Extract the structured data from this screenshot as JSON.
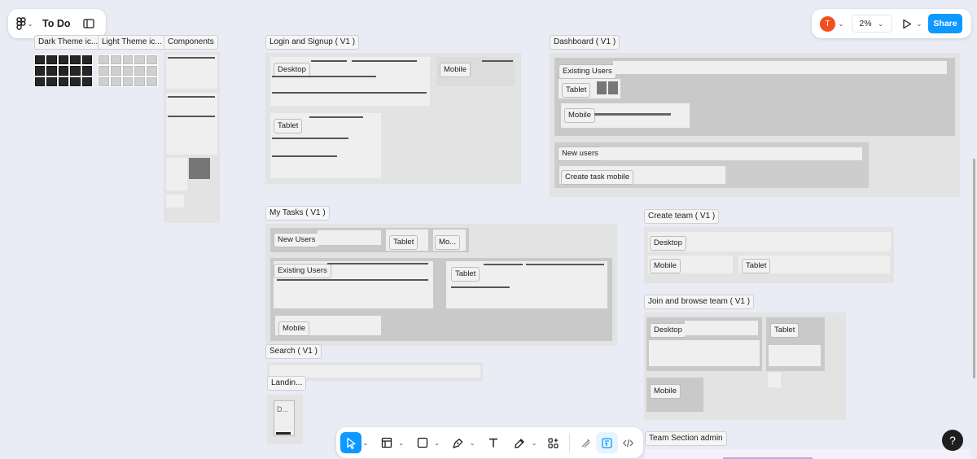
{
  "topbar": {
    "file_name": "To Do",
    "zoom": "2%",
    "avatar_initial": "T",
    "share_label": "Share"
  },
  "frames": {
    "dark_theme": "Dark Theme ic...",
    "light_theme": "Light Theme ic...",
    "components": "Components",
    "login": "Login and Signup ( V1 )",
    "dashboard": "Dashboard ( V1 )",
    "my_tasks": "My Tasks ( V1 )",
    "create_team": "Create team ( V1 )",
    "join_team": "Join and browse team ( V1 )",
    "search": "Search ( V1 )",
    "landing": "Landin...",
    "team_admin": "Team Section admin"
  },
  "labels": {
    "desktop": "Desktop",
    "mobile": "Mobile",
    "tablet": "Tablet",
    "existing_users": "Existing Users",
    "new_users": "New users",
    "new_users_cap": "New Users",
    "create_task_mobile": "Create task mobile",
    "mo": "Mo...",
    "landing_letter": "D..."
  },
  "help_label": "?",
  "colors": {
    "canvas": "#e9ebf5",
    "accent": "#0d99ff",
    "avatar": "#f24e1e"
  }
}
